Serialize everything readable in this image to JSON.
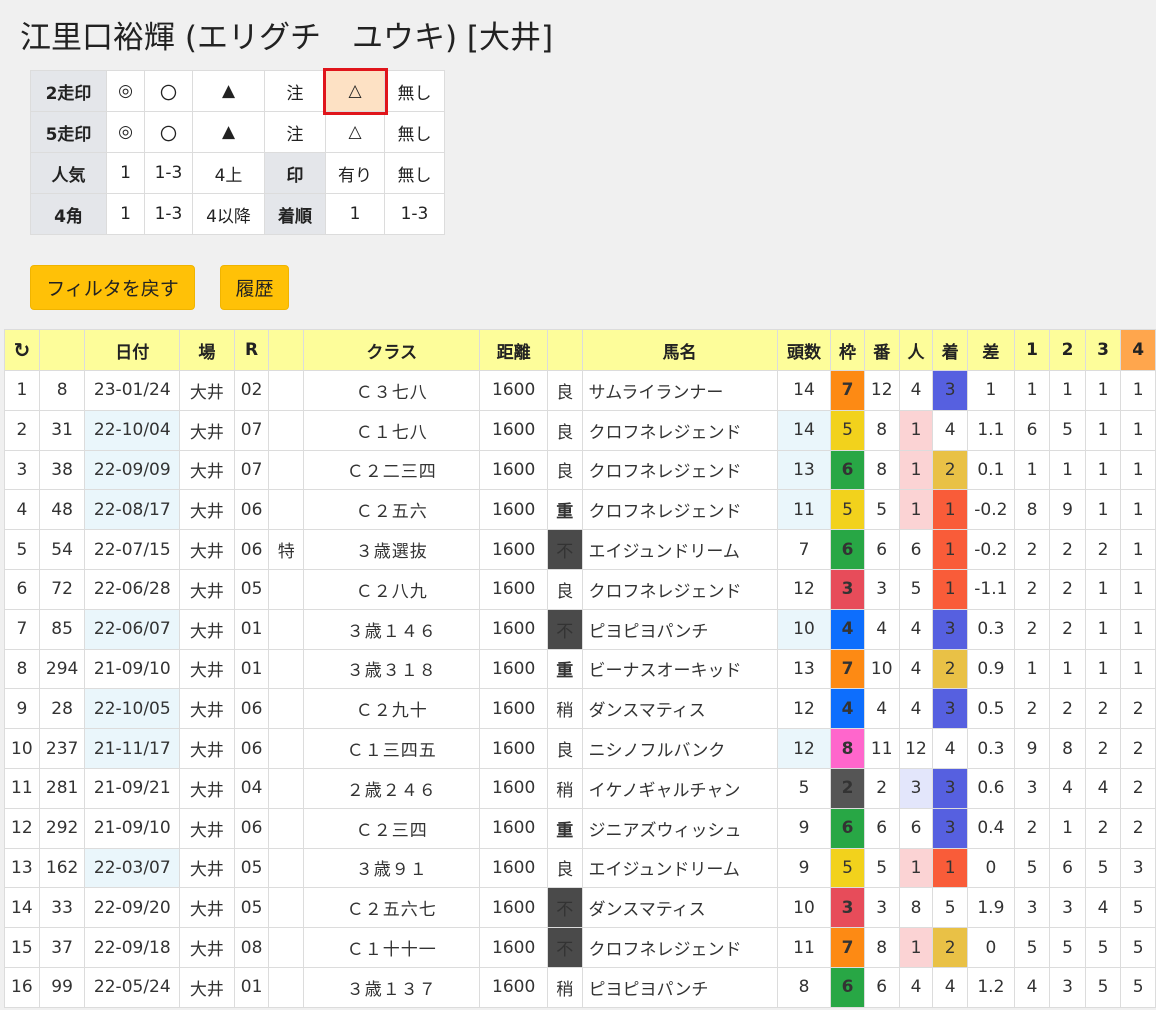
{
  "title": "江里口裕輝 (エリグチ　ユウキ) [大井]",
  "filter": {
    "rows": [
      {
        "label": "2走印",
        "cells": [
          "◎",
          "〇",
          "▲",
          "注",
          "△",
          "無し"
        ]
      },
      {
        "label": "5走印",
        "cells": [
          "◎",
          "〇",
          "▲",
          "注",
          "△",
          "無し"
        ]
      },
      {
        "label": "人気",
        "cells": [
          "1",
          "1-3",
          "4上",
          "印",
          "有り",
          "無し"
        ]
      },
      {
        "label": "4角",
        "cells": [
          "1",
          "1-3",
          "4以降",
          "着順",
          "1",
          "1-3"
        ]
      }
    ]
  },
  "buttons": {
    "reset": "フィルタを戻す",
    "history": "履歴"
  },
  "table": {
    "headers": [
      "",
      "",
      "日付",
      "場",
      "R",
      "",
      "クラス",
      "距離",
      "",
      "馬名",
      "頭数",
      "枠",
      "番",
      "人",
      "着",
      "差",
      "1",
      "2",
      "3",
      "4"
    ],
    "rows": [
      [
        "1",
        "8",
        "23-01/24",
        "大井",
        "02",
        "",
        "Ｃ３七八",
        "1600",
        "良",
        "サムライランナー",
        "14",
        "7",
        "12",
        "4",
        "3",
        "1",
        "1",
        "1",
        "1",
        "1"
      ],
      [
        "2",
        "31",
        "22-10/04",
        "大井",
        "07",
        "",
        "Ｃ１七八",
        "1600",
        "良",
        "クロフネレジェンド",
        "14",
        "5",
        "8",
        "1",
        "4",
        "1.1",
        "6",
        "5",
        "1",
        "1"
      ],
      [
        "3",
        "38",
        "22-09/09",
        "大井",
        "07",
        "",
        "Ｃ２二三四",
        "1600",
        "良",
        "クロフネレジェンド",
        "13",
        "6",
        "8",
        "1",
        "2",
        "0.1",
        "1",
        "1",
        "1",
        "1"
      ],
      [
        "4",
        "48",
        "22-08/17",
        "大井",
        "06",
        "",
        "Ｃ２五六",
        "1600",
        "重",
        "クロフネレジェンド",
        "11",
        "5",
        "5",
        "1",
        "1",
        "-0.2",
        "8",
        "9",
        "1",
        "1"
      ],
      [
        "5",
        "54",
        "22-07/15",
        "大井",
        "06",
        "特",
        "３歳選抜",
        "1600",
        "不",
        "エイジュンドリーム",
        "7",
        "6",
        "6",
        "6",
        "1",
        "-0.2",
        "2",
        "2",
        "2",
        "1"
      ],
      [
        "6",
        "72",
        "22-06/28",
        "大井",
        "05",
        "",
        "Ｃ２八九",
        "1600",
        "良",
        "クロフネレジェンド",
        "12",
        "3",
        "3",
        "5",
        "1",
        "-1.1",
        "2",
        "2",
        "1",
        "1"
      ],
      [
        "7",
        "85",
        "22-06/07",
        "大井",
        "01",
        "",
        "３歳１４６",
        "1600",
        "不",
        "ピヨピヨパンチ",
        "10",
        "4",
        "4",
        "4",
        "3",
        "0.3",
        "2",
        "2",
        "1",
        "1"
      ],
      [
        "8",
        "294",
        "21-09/10",
        "大井",
        "01",
        "",
        "３歳３１８",
        "1600",
        "重",
        "ビーナスオーキッド",
        "13",
        "7",
        "10",
        "4",
        "2",
        "0.9",
        "1",
        "1",
        "1",
        "1"
      ],
      [
        "9",
        "28",
        "22-10/05",
        "大井",
        "06",
        "",
        "Ｃ２九十",
        "1600",
        "稍",
        "ダンスマティス",
        "12",
        "4",
        "4",
        "4",
        "3",
        "0.5",
        "2",
        "2",
        "2",
        "2"
      ],
      [
        "10",
        "237",
        "21-11/17",
        "大井",
        "06",
        "",
        "Ｃ１三四五",
        "1600",
        "良",
        "ニシノフルバンク",
        "12",
        "8",
        "11",
        "12",
        "4",
        "0.3",
        "9",
        "8",
        "2",
        "2"
      ],
      [
        "11",
        "281",
        "21-09/21",
        "大井",
        "04",
        "",
        "２歳２４６",
        "1600",
        "稍",
        "イケノギャルチャン",
        "5",
        "2",
        "2",
        "3",
        "3",
        "0.6",
        "3",
        "4",
        "4",
        "2"
      ],
      [
        "12",
        "292",
        "21-09/10",
        "大井",
        "06",
        "",
        "Ｃ２三四",
        "1600",
        "重",
        "ジニアズウィッシュ",
        "9",
        "6",
        "6",
        "6",
        "3",
        "0.4",
        "2",
        "1",
        "2",
        "2"
      ],
      [
        "13",
        "162",
        "22-03/07",
        "大井",
        "05",
        "",
        "３歳９１",
        "1600",
        "良",
        "エイジュンドリーム",
        "9",
        "5",
        "5",
        "1",
        "1",
        "0",
        "5",
        "6",
        "5",
        "3"
      ],
      [
        "14",
        "33",
        "22-09/20",
        "大井",
        "05",
        "",
        "Ｃ２五六七",
        "1600",
        "不",
        "ダンスマティス",
        "10",
        "3",
        "3",
        "8",
        "5",
        "1.9",
        "3",
        "3",
        "4",
        "5"
      ],
      [
        "15",
        "37",
        "22-09/18",
        "大井",
        "08",
        "",
        "Ｃ１十十一",
        "1600",
        "不",
        "クロフネレジェンド",
        "11",
        "7",
        "8",
        "1",
        "2",
        "0",
        "5",
        "5",
        "5",
        "5"
      ],
      [
        "16",
        "99",
        "22-05/24",
        "大井",
        "01",
        "",
        "３歳１３７",
        "1600",
        "稍",
        "ピヨピヨパンチ",
        "8",
        "6",
        "6",
        "4",
        "4",
        "1.2",
        "4",
        "3",
        "5",
        "5"
      ]
    ]
  },
  "colors": {
    "header": "#fdfd9a",
    "button": "#ffc107",
    "selected": "#fde1c4",
    "highlight_border": "#e0151b"
  }
}
